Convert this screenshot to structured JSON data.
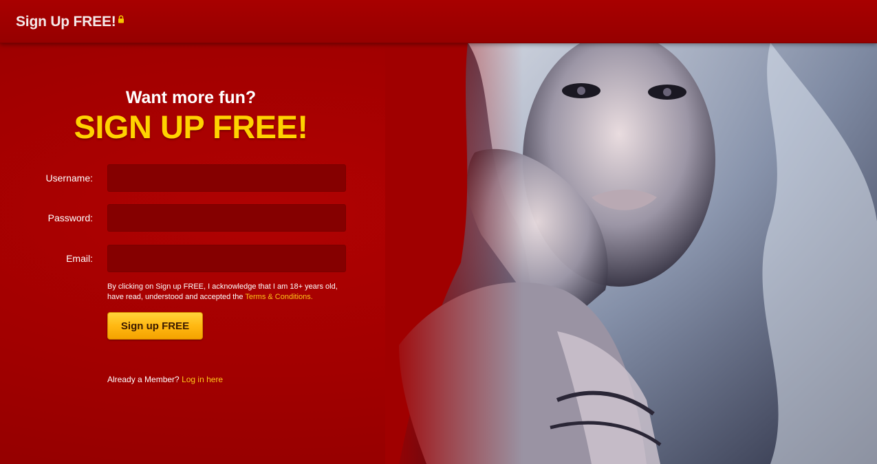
{
  "header": {
    "title": "Sign Up FREE!",
    "lock_icon": "lock-icon",
    "lock_color": "#f5c400"
  },
  "hero": {
    "tagline": "Want more fun?",
    "headline": "SIGN UP FREE!",
    "headline_color": "#ffd200"
  },
  "form": {
    "username_label": "Username:",
    "username_value": "",
    "password_label": "Password:",
    "password_value": "",
    "email_label": "Email:",
    "email_value": "",
    "disclaimer_line1": "By clicking on Sign up FREE, I acknowledge that I am 18+ years old,",
    "disclaimer_line2": "have read, understood and accepted the",
    "terms_link": "Terms & Conditions.",
    "submit_label": "Sign up FREE"
  },
  "footer": {
    "member_text": "Already a Member?",
    "login_link": "Log in here"
  },
  "colors": {
    "background": "#a00000",
    "input_bg": "#850000",
    "link": "#ffc61a",
    "button": "#ffb812"
  }
}
